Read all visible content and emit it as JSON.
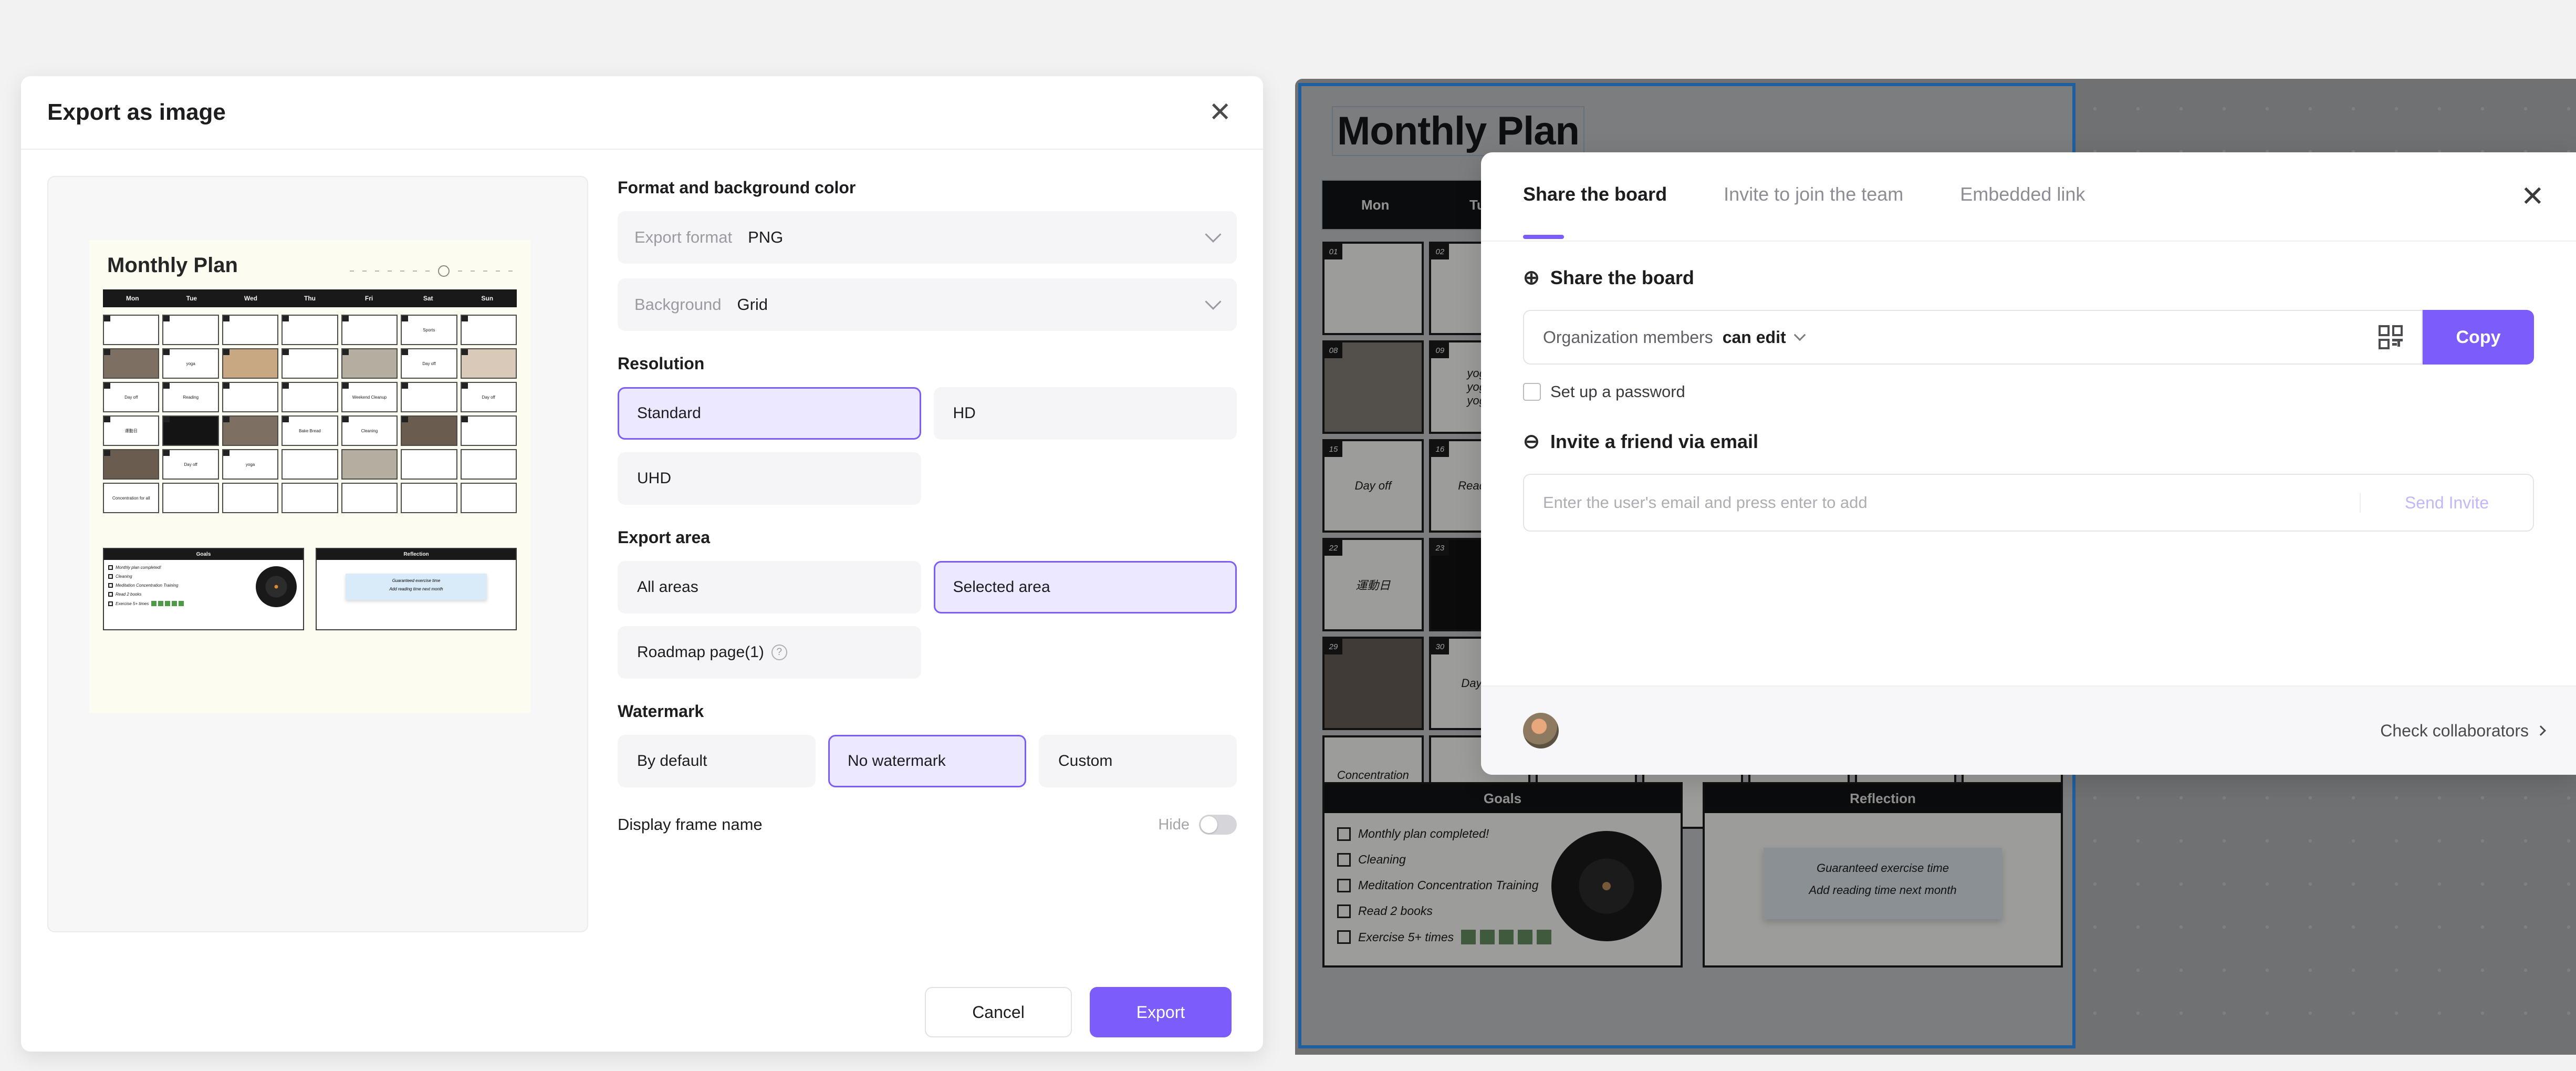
{
  "export_dialog": {
    "title": "Export as image",
    "close_icon": "close-icon",
    "sections": {
      "format_label": "Format and background color",
      "resolution_label": "Resolution",
      "export_area_label": "Export area",
      "watermark_label": "Watermark",
      "display_frame_label": "Display frame name"
    },
    "format_select": {
      "label": "Export format",
      "value": "PNG",
      "chevron": "chevron-down-icon"
    },
    "background_select": {
      "label": "Background",
      "value": "Grid",
      "chevron": "chevron-down-icon"
    },
    "resolution_options": [
      {
        "label": "Standard",
        "selected": true
      },
      {
        "label": "HD",
        "selected": false
      },
      {
        "label": "UHD",
        "selected": false
      }
    ],
    "export_area_options": [
      {
        "label": "All areas",
        "selected": false
      },
      {
        "label": "Selected area",
        "selected": true
      },
      {
        "label": "Roadmap page(1)",
        "selected": false,
        "help_icon": "question-mark-icon",
        "help_glyph": "?"
      }
    ],
    "watermark_options": [
      {
        "label": "By default",
        "selected": false
      },
      {
        "label": "No watermark",
        "selected": true
      },
      {
        "label": "Custom",
        "selected": false
      }
    ],
    "display_frame_toggle": {
      "label": "Hide",
      "state": "off"
    },
    "footer": {
      "cancel_label": "Cancel",
      "export_label": "Export"
    },
    "accent_color": "#7C5CFA",
    "selected_bg_color": "#ECE8FF"
  },
  "preview": {
    "board_title": "Monthly Plan",
    "day_headers": [
      "Mon",
      "Tue",
      "Wed",
      "Thu",
      "Fri",
      "Sat",
      "Sun"
    ],
    "cells": [
      {
        "n": "01",
        "text": ""
      },
      {
        "n": "02",
        "text": ""
      },
      {
        "n": "03",
        "text": ""
      },
      {
        "n": "04",
        "text": ""
      },
      {
        "n": "05",
        "text": ""
      },
      {
        "n": "06",
        "text": "Sports"
      },
      {
        "n": "07",
        "text": "",
        "diag": true
      },
      {
        "n": "08",
        "text": "",
        "photo": "ph1"
      },
      {
        "n": "09",
        "text": "yoga"
      },
      {
        "n": "10",
        "text": "",
        "photo": "ph2"
      },
      {
        "n": "11",
        "text": ""
      },
      {
        "n": "12",
        "text": "",
        "photo": "ph3"
      },
      {
        "n": "13",
        "text": "Day off"
      },
      {
        "n": "14",
        "text": "",
        "photo": "ph5"
      },
      {
        "n": "15",
        "text": "Day off"
      },
      {
        "n": "16",
        "text": "Reading"
      },
      {
        "n": "17",
        "text": ""
      },
      {
        "n": "18",
        "text": ""
      },
      {
        "n": "19",
        "text": "Weekend Cleanup"
      },
      {
        "n": "20",
        "text": "",
        "diag": true
      },
      {
        "n": "21",
        "text": "Day off"
      },
      {
        "n": "22",
        "text": "運動日"
      },
      {
        "n": "23",
        "text": "",
        "photo": "dk"
      },
      {
        "n": "24",
        "text": "",
        "photo": "ph1"
      },
      {
        "n": "25",
        "text": "Bake Bread"
      },
      {
        "n": "26",
        "text": "Cleaning"
      },
      {
        "n": "27",
        "text": "",
        "photo": "ph4"
      },
      {
        "n": "28",
        "text": ""
      },
      {
        "n": "29",
        "text": "",
        "photo": "ph4"
      },
      {
        "n": "30",
        "text": "Day off"
      },
      {
        "n": "31",
        "text": "yoga"
      },
      {
        "n": "",
        "text": ""
      },
      {
        "n": "",
        "text": "",
        "photo": "ph3"
      },
      {
        "n": "",
        "text": ""
      },
      {
        "n": "",
        "text": ""
      },
      {
        "n": "",
        "text": "Concentration for all"
      },
      {
        "n": "",
        "text": ""
      },
      {
        "n": "",
        "text": ""
      },
      {
        "n": "",
        "text": ""
      },
      {
        "n": "",
        "text": ""
      },
      {
        "n": "",
        "text": ""
      },
      {
        "n": "",
        "text": ""
      }
    ],
    "goals_card": {
      "title": "Goals",
      "items": [
        {
          "text": "Monthly plan completed!"
        },
        {
          "text": "Cleaning"
        },
        {
          "text": "Meditation Concentration Training"
        },
        {
          "text": "Read 2 books"
        },
        {
          "text": "Exercise 5+ times",
          "checks": 5
        }
      ]
    },
    "reflection_card": {
      "title": "Reflection",
      "lines": [
        "Guaranteed exercise time",
        "Add reading time next month"
      ]
    }
  },
  "share_panel": {
    "tabs": [
      {
        "label": "Share the board",
        "active": true
      },
      {
        "label": "Invite to join the team",
        "active": false
      },
      {
        "label": "Embedded link",
        "active": false
      }
    ],
    "close_icon": "close-icon",
    "share_section": {
      "heading": "Share the board",
      "heading_icon": "globe-icon",
      "heading_glyph": "⊕",
      "permission_scope": "Organization members",
      "permission_level": "can edit",
      "chevron": "chevron-down-icon",
      "qr_icon": "qr-code-icon",
      "copy_label": "Copy"
    },
    "password_checkbox": {
      "label": "Set up a password",
      "checked": false
    },
    "invite_section": {
      "heading": "Invite a friend via email",
      "heading_icon": "envelope-icon",
      "heading_glyph": "⊖",
      "email_placeholder": "Enter the user's email and press enter to add",
      "email_value": "",
      "send_label": "Send Invite"
    },
    "footer": {
      "avatar": "user-avatar",
      "collaborators_label": "Check collaborators",
      "chevron": "chevron-right-icon"
    },
    "accent_color": "#7C5CFA"
  },
  "board": {
    "title": "Monthly Plan",
    "day_headers": [
      "Mon",
      "Tue",
      "Wed",
      "Thu",
      "Fri",
      "Sat",
      "Sun"
    ],
    "goals_title": "Goals",
    "reflection_title": "Reflection",
    "goals_items": [
      "Monthly plan completed!",
      "Cleaning",
      "Meditation Concentration Training",
      "Read 2 books",
      "Exercise 5+ times"
    ],
    "reflection_lines": [
      "Guaranteed exercise time",
      "Add reading time next month"
    ],
    "selection_border_color": "#1F5FA0",
    "canvas_color": "#6F7173"
  }
}
